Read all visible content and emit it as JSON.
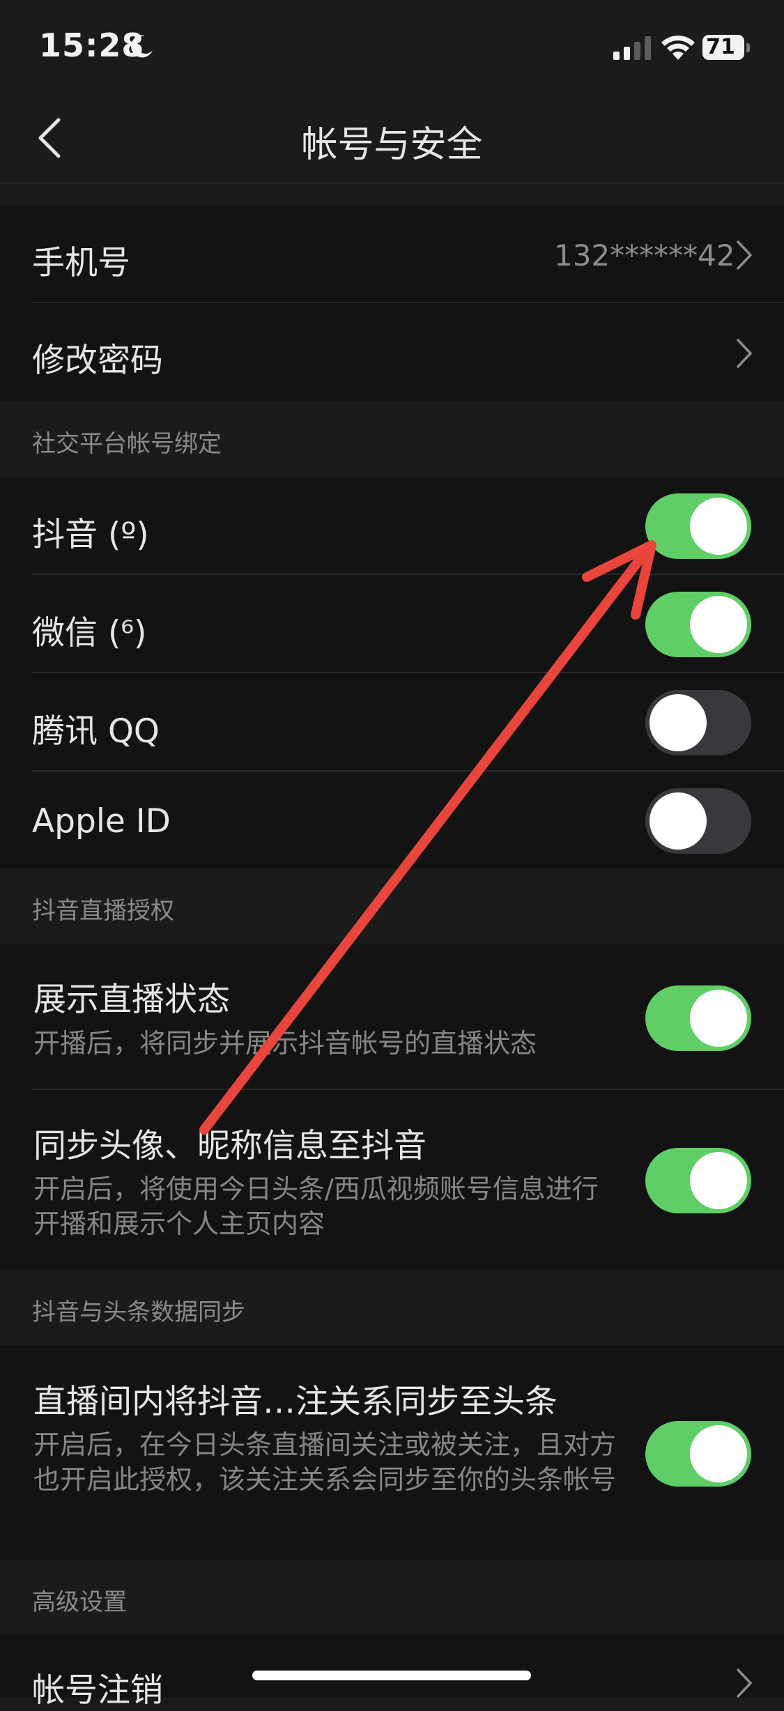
{
  "status": {
    "time": "15:28",
    "battery": "71",
    "moon_icon": "moon-icon",
    "signal_icon": "signal-icon",
    "wifi_icon": "wifi-icon"
  },
  "nav": {
    "title": "帐号与安全",
    "back_icon": "chevron-left-icon"
  },
  "account": {
    "phone_label": "手机号",
    "phone_value": "132******42",
    "password_label": "修改密码"
  },
  "social": {
    "header": "社交平台帐号绑定",
    "items": [
      {
        "label": "抖音 (º)",
        "on": true
      },
      {
        "label": "微信 (⁶)",
        "on": true
      },
      {
        "label": "腾讯 QQ",
        "on": false
      },
      {
        "label": "Apple ID",
        "on": false
      }
    ]
  },
  "live_auth": {
    "header": "抖音直播授权",
    "items": [
      {
        "title": "展示直播状态",
        "subtitle": "开播后，将同步并展示抖音帐号的直播状态",
        "on": true
      },
      {
        "title": "同步头像、昵称信息至抖音",
        "subtitle": "开启后，将使用今日头条/西瓜视频账号信息进行开播和展示个人主页内容",
        "on": true
      }
    ]
  },
  "data_sync": {
    "header": "抖音与头条数据同步",
    "items": [
      {
        "title": "直播间内将抖音…注关系同步至头条",
        "subtitle": "开启后，在今日头条直播间关注或被关注，且对方也开启此授权，该关注关系会同步至你的头条帐号",
        "on": true
      }
    ]
  },
  "advanced": {
    "header": "高级设置",
    "deactivate_label": "帐号注销"
  },
  "colors": {
    "toggle_on": "#5fce67",
    "toggle_off": "#39393d",
    "annotation_arrow": "#e8453c",
    "background": "#1b1b1b",
    "panel": "#131313"
  }
}
